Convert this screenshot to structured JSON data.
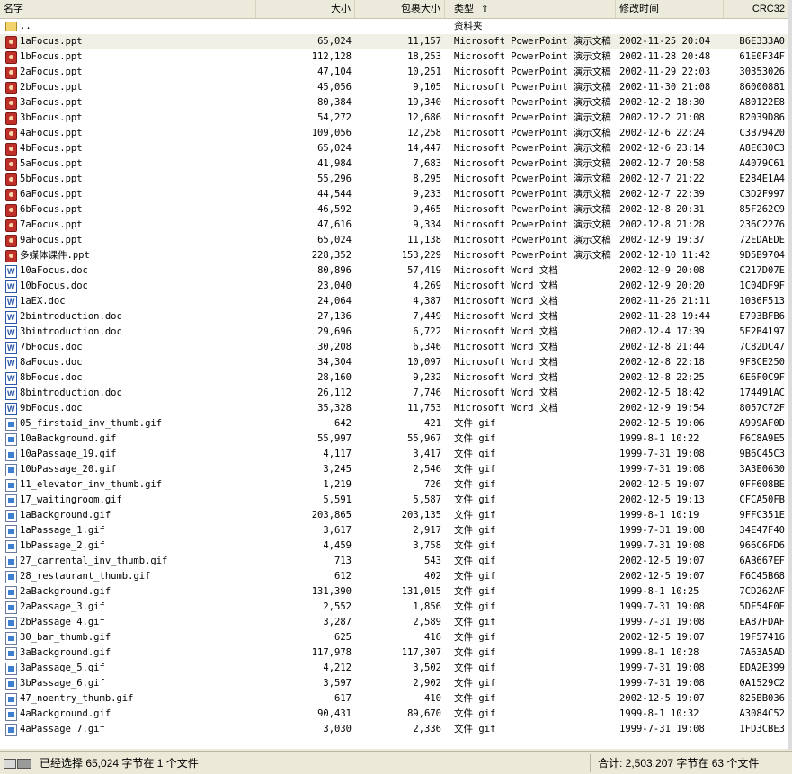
{
  "columns": {
    "name": "名字",
    "size": "大小",
    "packed": "包裹大小",
    "type": "类型",
    "modified": "修改时间",
    "crc": "CRC32"
  },
  "files": [
    {
      "icon": "folder",
      "name": "..",
      "size": "",
      "packed": "",
      "type": "资料夹",
      "modified": "",
      "crc": ""
    },
    {
      "icon": "ppt",
      "name": "1aFocus.ppt",
      "size": "65,024",
      "packed": "11,157",
      "type": "Microsoft PowerPoint 演示文稿",
      "modified": "2002-11-25 20:04",
      "crc": "B6E333A0",
      "selected": true
    },
    {
      "icon": "ppt",
      "name": "1bFocus.ppt",
      "size": "112,128",
      "packed": "18,253",
      "type": "Microsoft PowerPoint 演示文稿",
      "modified": "2002-11-28 20:48",
      "crc": "61E0F34F"
    },
    {
      "icon": "ppt",
      "name": "2aFocus.ppt",
      "size": "47,104",
      "packed": "10,251",
      "type": "Microsoft PowerPoint 演示文稿",
      "modified": "2002-11-29 22:03",
      "crc": "30353026"
    },
    {
      "icon": "ppt",
      "name": "2bFocus.ppt",
      "size": "45,056",
      "packed": "9,105",
      "type": "Microsoft PowerPoint 演示文稿",
      "modified": "2002-11-30 21:08",
      "crc": "86000881"
    },
    {
      "icon": "ppt",
      "name": "3aFocus.ppt",
      "size": "80,384",
      "packed": "19,340",
      "type": "Microsoft PowerPoint 演示文稿",
      "modified": "2002-12-2 18:30",
      "crc": "A80122E8"
    },
    {
      "icon": "ppt",
      "name": "3bFocus.ppt",
      "size": "54,272",
      "packed": "12,686",
      "type": "Microsoft PowerPoint 演示文稿",
      "modified": "2002-12-2 21:08",
      "crc": "B2039D86"
    },
    {
      "icon": "ppt",
      "name": "4aFocus.ppt",
      "size": "109,056",
      "packed": "12,258",
      "type": "Microsoft PowerPoint 演示文稿",
      "modified": "2002-12-6 22:24",
      "crc": "C3B79420"
    },
    {
      "icon": "ppt",
      "name": "4bFocus.ppt",
      "size": "65,024",
      "packed": "14,447",
      "type": "Microsoft PowerPoint 演示文稿",
      "modified": "2002-12-6 23:14",
      "crc": "A8E630C3"
    },
    {
      "icon": "ppt",
      "name": "5aFocus.ppt",
      "size": "41,984",
      "packed": "7,683",
      "type": "Microsoft PowerPoint 演示文稿",
      "modified": "2002-12-7 20:58",
      "crc": "A4079C61"
    },
    {
      "icon": "ppt",
      "name": "5bFocus.ppt",
      "size": "55,296",
      "packed": "8,295",
      "type": "Microsoft PowerPoint 演示文稿",
      "modified": "2002-12-7 21:22",
      "crc": "E284E1A4"
    },
    {
      "icon": "ppt",
      "name": "6aFocus.ppt",
      "size": "44,544",
      "packed": "9,233",
      "type": "Microsoft PowerPoint 演示文稿",
      "modified": "2002-12-7 22:39",
      "crc": "C3D2F997"
    },
    {
      "icon": "ppt",
      "name": "6bFocus.ppt",
      "size": "46,592",
      "packed": "9,465",
      "type": "Microsoft PowerPoint 演示文稿",
      "modified": "2002-12-8 20:31",
      "crc": "85F262C9"
    },
    {
      "icon": "ppt",
      "name": "7aFocus.ppt",
      "size": "47,616",
      "packed": "9,334",
      "type": "Microsoft PowerPoint 演示文稿",
      "modified": "2002-12-8 21:28",
      "crc": "236C2276"
    },
    {
      "icon": "ppt",
      "name": "9aFocus.ppt",
      "size": "65,024",
      "packed": "11,138",
      "type": "Microsoft PowerPoint 演示文稿",
      "modified": "2002-12-9 19:37",
      "crc": "72EDAEDE"
    },
    {
      "icon": "ppt",
      "name": "多媒体课件.ppt",
      "size": "228,352",
      "packed": "153,229",
      "type": "Microsoft PowerPoint 演示文稿",
      "modified": "2002-12-10 11:42",
      "crc": "9D5B9704"
    },
    {
      "icon": "doc",
      "name": "10aFocus.doc",
      "size": "80,896",
      "packed": "57,419",
      "type": "Microsoft Word 文档",
      "modified": "2002-12-9 20:08",
      "crc": "C217D07E"
    },
    {
      "icon": "doc",
      "name": "10bFocus.doc",
      "size": "23,040",
      "packed": "4,269",
      "type": "Microsoft Word 文档",
      "modified": "2002-12-9 20:20",
      "crc": "1C04DF9F"
    },
    {
      "icon": "doc",
      "name": "1aEX.doc",
      "size": "24,064",
      "packed": "4,387",
      "type": "Microsoft Word 文档",
      "modified": "2002-11-26 21:11",
      "crc": "1036F513"
    },
    {
      "icon": "doc",
      "name": "2bintroduction.doc",
      "size": "27,136",
      "packed": "7,449",
      "type": "Microsoft Word 文档",
      "modified": "2002-11-28 19:44",
      "crc": "E793BFB6"
    },
    {
      "icon": "doc",
      "name": "3bintroduction.doc",
      "size": "29,696",
      "packed": "6,722",
      "type": "Microsoft Word 文档",
      "modified": "2002-12-4 17:39",
      "crc": "5E2B4197"
    },
    {
      "icon": "doc",
      "name": "7bFocus.doc",
      "size": "30,208",
      "packed": "6,346",
      "type": "Microsoft Word 文档",
      "modified": "2002-12-8 21:44",
      "crc": "7C82DC47"
    },
    {
      "icon": "doc",
      "name": "8aFocus.doc",
      "size": "34,304",
      "packed": "10,097",
      "type": "Microsoft Word 文档",
      "modified": "2002-12-8 22:18",
      "crc": "9F8CE250"
    },
    {
      "icon": "doc",
      "name": "8bFocus.doc",
      "size": "28,160",
      "packed": "9,232",
      "type": "Microsoft Word 文档",
      "modified": "2002-12-8 22:25",
      "crc": "6E6F0C9F"
    },
    {
      "icon": "doc",
      "name": "8bintroduction.doc",
      "size": "26,112",
      "packed": "7,746",
      "type": "Microsoft Word 文档",
      "modified": "2002-12-5 18:42",
      "crc": "174491AC"
    },
    {
      "icon": "doc",
      "name": "9bFocus.doc",
      "size": "35,328",
      "packed": "11,753",
      "type": "Microsoft Word 文档",
      "modified": "2002-12-9 19:54",
      "crc": "8057C72F"
    },
    {
      "icon": "gif",
      "name": "05_firstaid_inv_thumb.gif",
      "size": "642",
      "packed": "421",
      "type": "文件 gif",
      "modified": "2002-12-5 19:06",
      "crc": "A999AF0D"
    },
    {
      "icon": "gif",
      "name": "10aBackground.gif",
      "size": "55,997",
      "packed": "55,967",
      "type": "文件 gif",
      "modified": "1999-8-1 10:22",
      "crc": "F6C8A9E5"
    },
    {
      "icon": "gif",
      "name": "10aPassage_19.gif",
      "size": "4,117",
      "packed": "3,417",
      "type": "文件 gif",
      "modified": "1999-7-31 19:08",
      "crc": "9B6C45C3"
    },
    {
      "icon": "gif",
      "name": "10bPassage_20.gif",
      "size": "3,245",
      "packed": "2,546",
      "type": "文件 gif",
      "modified": "1999-7-31 19:08",
      "crc": "3A3E0630"
    },
    {
      "icon": "gif",
      "name": "11_elevator_inv_thumb.gif",
      "size": "1,219",
      "packed": "726",
      "type": "文件 gif",
      "modified": "2002-12-5 19:07",
      "crc": "0FF608BE"
    },
    {
      "icon": "gif",
      "name": "17_waitingroom.gif",
      "size": "5,591",
      "packed": "5,587",
      "type": "文件 gif",
      "modified": "2002-12-5 19:13",
      "crc": "CFCA50FB"
    },
    {
      "icon": "gif",
      "name": "1aBackground.gif",
      "size": "203,865",
      "packed": "203,135",
      "type": "文件 gif",
      "modified": "1999-8-1 10:19",
      "crc": "9FFC351E"
    },
    {
      "icon": "gif",
      "name": "1aPassage_1.gif",
      "size": "3,617",
      "packed": "2,917",
      "type": "文件 gif",
      "modified": "1999-7-31 19:08",
      "crc": "34E47F40"
    },
    {
      "icon": "gif",
      "name": "1bPassage_2.gif",
      "size": "4,459",
      "packed": "3,758",
      "type": "文件 gif",
      "modified": "1999-7-31 19:08",
      "crc": "966C6FD6"
    },
    {
      "icon": "gif",
      "name": "27_carrental_inv_thumb.gif",
      "size": "713",
      "packed": "543",
      "type": "文件 gif",
      "modified": "2002-12-5 19:07",
      "crc": "6AB667EF"
    },
    {
      "icon": "gif",
      "name": "28_restaurant_thumb.gif",
      "size": "612",
      "packed": "402",
      "type": "文件 gif",
      "modified": "2002-12-5 19:07",
      "crc": "F6C45B68"
    },
    {
      "icon": "gif",
      "name": "2aBackground.gif",
      "size": "131,390",
      "packed": "131,015",
      "type": "文件 gif",
      "modified": "1999-8-1 10:25",
      "crc": "7CD262AF"
    },
    {
      "icon": "gif",
      "name": "2aPassage_3.gif",
      "size": "2,552",
      "packed": "1,856",
      "type": "文件 gif",
      "modified": "1999-7-31 19:08",
      "crc": "5DF54E0E"
    },
    {
      "icon": "gif",
      "name": "2bPassage_4.gif",
      "size": "3,287",
      "packed": "2,589",
      "type": "文件 gif",
      "modified": "1999-7-31 19:08",
      "crc": "EA87FDAF"
    },
    {
      "icon": "gif",
      "name": "30_bar_thumb.gif",
      "size": "625",
      "packed": "416",
      "type": "文件 gif",
      "modified": "2002-12-5 19:07",
      "crc": "19F57416"
    },
    {
      "icon": "gif",
      "name": "3aBackground.gif",
      "size": "117,978",
      "packed": "117,307",
      "type": "文件 gif",
      "modified": "1999-8-1 10:28",
      "crc": "7A63A5AD"
    },
    {
      "icon": "gif",
      "name": "3aPassage_5.gif",
      "size": "4,212",
      "packed": "3,502",
      "type": "文件 gif",
      "modified": "1999-7-31 19:08",
      "crc": "EDA2E399"
    },
    {
      "icon": "gif",
      "name": "3bPassage_6.gif",
      "size": "3,597",
      "packed": "2,902",
      "type": "文件 gif",
      "modified": "1999-7-31 19:08",
      "crc": "0A1529C2"
    },
    {
      "icon": "gif",
      "name": "47_noentry_thumb.gif",
      "size": "617",
      "packed": "410",
      "type": "文件 gif",
      "modified": "2002-12-5 19:07",
      "crc": "825BB036"
    },
    {
      "icon": "gif",
      "name": "4aBackground.gif",
      "size": "90,431",
      "packed": "89,670",
      "type": "文件 gif",
      "modified": "1999-8-1 10:32",
      "crc": "A3084C52"
    },
    {
      "icon": "gif",
      "name": "4aPassage_7.gif",
      "size": "3,030",
      "packed": "2,336",
      "type": "文件 gif",
      "modified": "1999-7-31 19:08",
      "crc": "1FD3CBE3"
    }
  ],
  "status": {
    "selection": "已经选择 65,024 字节在 1 个文件",
    "total": "合计: 2,503,207 字节在 63 个文件"
  }
}
